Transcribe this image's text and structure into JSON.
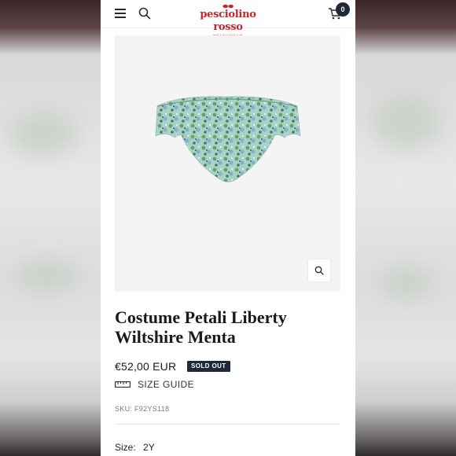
{
  "header": {
    "brand_name": "pesciolino rosso",
    "brand_tagline": "BEACHWEAR",
    "cart_count": "0"
  },
  "icons": {
    "menu": "hamburger-icon",
    "search": "search-icon",
    "cart": "cart-icon",
    "zoom": "zoom-icon",
    "ruler": "ruler-icon"
  },
  "product": {
    "title": "Costume Petali Liberty Wiltshire Menta",
    "price": "€52,00 EUR",
    "badge": "SOLD OUT",
    "size_guide_label": "SIZE GUIDE",
    "sku": "SKU: F92YS118",
    "size_label": "Size:",
    "size_value": "2Y"
  },
  "colors": {
    "brand_red": "#c4262e",
    "badge_navy": "#1e2a38",
    "image_background": "#f4f4f4",
    "print_green": "#5fa36a",
    "print_blue": "#7fb3c9"
  }
}
